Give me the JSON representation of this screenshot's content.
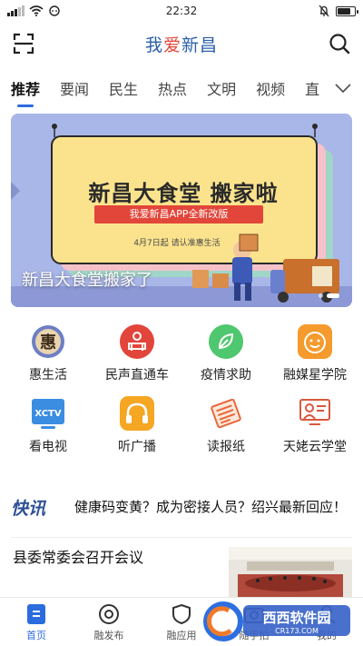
{
  "status_bar": {
    "time": "22:32"
  },
  "header": {
    "logo_part1": "我",
    "logo_part2": "爱",
    "logo_part3": "新昌"
  },
  "tabs": [
    {
      "label": "推荐",
      "active": true
    },
    {
      "label": "要闻"
    },
    {
      "label": "民生"
    },
    {
      "label": "热点"
    },
    {
      "label": "文明"
    },
    {
      "label": "视频"
    },
    {
      "label": "直"
    }
  ],
  "banner": {
    "title": "新昌大食堂搬家了",
    "poster_heading": "新昌大食堂 搬家啦",
    "poster_sub": "我爱新昌APP全新改版",
    "poster_note": "4月7日起 请认准惠生活",
    "slide_count": 2,
    "active_slide": 2
  },
  "grid": [
    {
      "label": "惠生活",
      "icon": "hui-life-icon"
    },
    {
      "label": "民声直通车",
      "icon": "people-voice-icon"
    },
    {
      "label": "疫情求助",
      "icon": "leaf-help-icon"
    },
    {
      "label": "融媒星学院",
      "icon": "smiley-academy-icon"
    },
    {
      "label": "看电视",
      "icon": "tv-icon"
    },
    {
      "label": "听广播",
      "icon": "headphones-icon"
    },
    {
      "label": "读报纸",
      "icon": "newspaper-icon"
    },
    {
      "label": "天姥云学堂",
      "icon": "cloud-classroom-icon"
    }
  ],
  "news_flash": {
    "logo": "快讯",
    "text": "健康码变黄？成为密接人员？绍兴最新回应！"
  },
  "article": {
    "title": "县委常委会召开会议"
  },
  "bottom_nav": [
    {
      "label": "首页",
      "active": true
    },
    {
      "label": "融发布"
    },
    {
      "label": "融应用"
    },
    {
      "label": "随手拍"
    },
    {
      "label": "我的"
    }
  ],
  "watermark": {
    "brand": "西西软件园",
    "url": "CR173.COM"
  },
  "colors": {
    "accent": "#2b6cdf",
    "logo_blue": "#2b5fab",
    "logo_red": "#e0463c",
    "banner_bg": "#a9b6e8"
  }
}
